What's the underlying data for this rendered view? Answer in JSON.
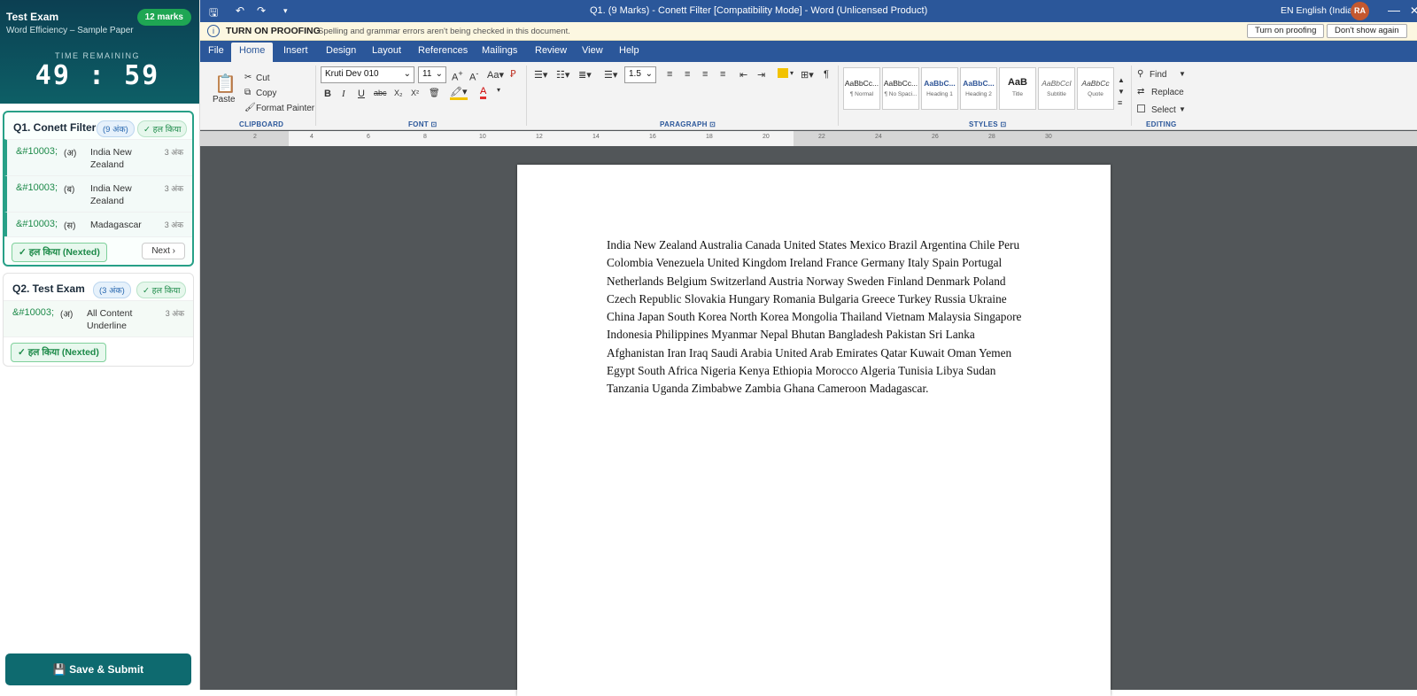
{
  "exam": {
    "title": "Test Exam",
    "subtitle": "Word Efficiency – Sample Paper",
    "marks": "12 marks",
    "time_label": "TIME REMAINING",
    "timer": "49 : 59"
  },
  "questions": [
    {
      "title": "Q1. Conett Filter",
      "marks_pill": "(9 अंक)",
      "status_pill": "✓ हल किया",
      "subs": [
        {
          "code": "&#10003;",
          "label": "(अ)",
          "text": "India New Zealand",
          "marks": "3 अंक"
        },
        {
          "code": "&#10003;",
          "label": "(ब)",
          "text": "India New Zealand",
          "marks": "3 अंक"
        },
        {
          "code": "&#10003;",
          "label": "(स)",
          "text": "Madagascar",
          "marks": "3 अंक"
        }
      ],
      "solved_btn": "✓ हल किया (Nexted)",
      "next_btn": "Next ›"
    },
    {
      "title": "Q2. Test Exam",
      "marks_pill": "(3 अंक)",
      "status_pill": "✓ हल किया",
      "subs": [
        {
          "code": "&#10003;",
          "label": "(अ)",
          "text": "All Content Underline",
          "marks": "3 अंक"
        }
      ],
      "solved_btn": "✓ हल किया (Nexted)"
    }
  ],
  "submit_btn": "💾  Save & Submit",
  "word": {
    "doc_title": "Q1. (9 Marks) - Conett Filter [Compatibility Mode] - Word (Unlicensed Product)",
    "language": "EN English (India)",
    "avatar": "RA",
    "proofing": {
      "heading": "TURN ON PROOFING",
      "message": "Spelling and grammar errors aren't being checked in this document.",
      "turn_on_btn": "Turn on proofing",
      "dont_show_btn": "Don't show again"
    },
    "tabs": [
      "File",
      "Home",
      "Insert",
      "Design",
      "Layout",
      "References",
      "Mailings",
      "Review",
      "View",
      "Help"
    ],
    "clipboard": {
      "paste": "Paste",
      "cut": "Cut",
      "copy": "Copy",
      "format_painter": "Format Painter",
      "group": "CLIPBOARD"
    },
    "font": {
      "name": "Kruti Dev 010",
      "size": "11",
      "group": "FONT ⊡"
    },
    "paragraph": {
      "spacing": "1.5",
      "group": "PARAGRAPH ⊡"
    },
    "styles": {
      "items": [
        {
          "preview": "AaBbCc...",
          "name": "¶ Normal"
        },
        {
          "preview": "AaBbCc...",
          "name": "¶ No Spaci..."
        },
        {
          "preview": "AaBbC...",
          "name": "Heading 1"
        },
        {
          "preview": "AaBbC...",
          "name": "Heading 2"
        },
        {
          "preview": "AaB",
          "name": "Title"
        },
        {
          "preview": "AaBbCcI",
          "name": "Subtitle"
        },
        {
          "preview": "AaBbCc",
          "name": "Quote"
        }
      ],
      "group": "STYLES ⊡"
    },
    "editing": {
      "find": "Find",
      "replace": "Replace",
      "select": "Select",
      "group": "EDITING"
    },
    "ruler_numbers": [
      "2",
      "4",
      "6",
      "8",
      "10",
      "12",
      "14",
      "16",
      "18",
      "20",
      "22",
      "24",
      "26",
      "28",
      "30"
    ],
    "document_text": "India New Zealand Australia Canada United States Mexico Brazil Argentina Chile Peru Colombia Venezuela United Kingdom Ireland France Germany Italy Spain Portugal Netherlands Belgium Switzerland Austria Norway Sweden Finland Denmark Poland Czech Republic Slovakia Hungary Romania Bulgaria Greece Turkey Russia Ukraine China Japan South Korea North Korea Mongolia Thailand Vietnam Malaysia Singapore Indonesia Philippines Myanmar Nepal Bhutan Bangladesh Pakistan Sri Lanka Afghanistan Iran Iraq Saudi Arabia United Arab Emirates Qatar Kuwait Oman Yemen Egypt South Africa Nigeria Kenya Ethiopia Morocco Algeria Tunisia Libya Sudan Tanzania Uganda Zimbabwe Zambia Ghana Cameroon Madagascar."
  }
}
